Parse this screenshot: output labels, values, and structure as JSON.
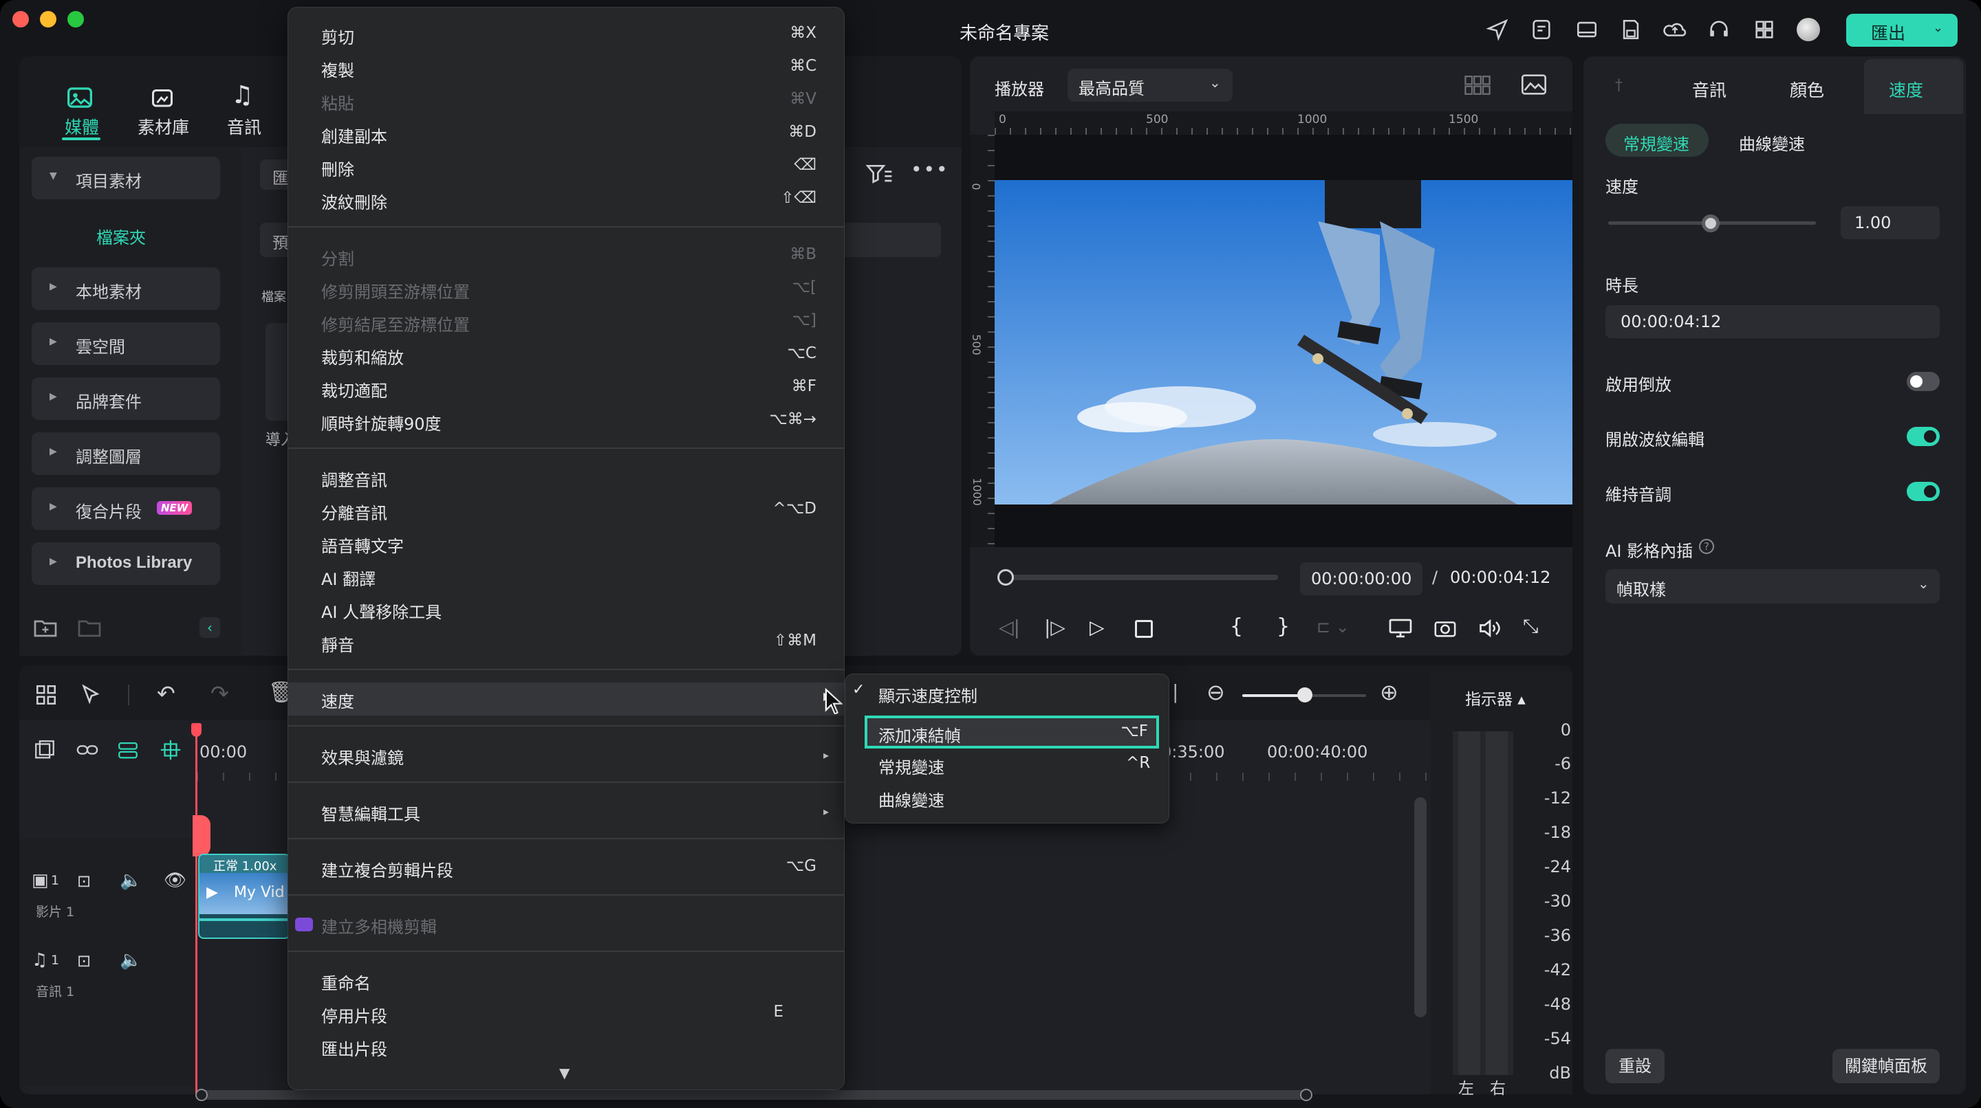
{
  "app": {
    "title": "未命名專案",
    "export_label": "匯出",
    "accent": "#2fd8b5",
    "icons": [
      "send-icon",
      "task-icon",
      "layout-icon",
      "save-icon",
      "cloud-upload-icon",
      "headset-icon",
      "grid-icon",
      "avatar"
    ]
  },
  "media_tabs": [
    {
      "label": "媒體",
      "icon": "media-icon",
      "active": true
    },
    {
      "label": "素材庫",
      "icon": "stock-icon",
      "active": false
    },
    {
      "label": "音訊",
      "icon": "music-icon",
      "active": false
    }
  ],
  "sidebar": {
    "project_media": "項目素材",
    "folder": "檔案夾",
    "items": [
      "本地素材",
      "雲空間",
      "品牌套件",
      "調整圖層",
      "復合片段",
      "Photos Library"
    ],
    "new_badge": "NEW"
  },
  "media_panel": {
    "tab_partial": "匯",
    "search_partial": "預",
    "folder_partial": "檔案",
    "import_partial": "導入"
  },
  "player": {
    "label": "播放器",
    "quality": "最高品質",
    "ruler_marks": [
      "0",
      "500",
      "1000",
      "1500"
    ],
    "vruler_marks": [
      "0",
      "500",
      "1000"
    ],
    "current_time": "00:00:00:00",
    "separator": "/",
    "total_time": "00:00:04:12",
    "progress": 0
  },
  "inspector": {
    "tabs": [
      "音訊",
      "顏色",
      "速度"
    ],
    "active_tab": "速度",
    "speed_modes": [
      "常規變速",
      "曲線變速"
    ],
    "speed_label": "速度",
    "speed_value": "1.00",
    "duration_label": "時長",
    "duration_value": "00:00:04:12",
    "toggles": [
      {
        "label": "啟用倒放",
        "on": false
      },
      {
        "label": "開啟波紋編輯",
        "on": true
      },
      {
        "label": "維持音調",
        "on": true
      }
    ],
    "ai_label": "AI 影格內插",
    "ai_value": "幀取樣",
    "reset": "重設",
    "keyframe_panel": "關鍵幀面板"
  },
  "context_menu": {
    "items": [
      {
        "label": "剪切",
        "shortcut": "⌘X",
        "disabled": false
      },
      {
        "label": "複製",
        "shortcut": "⌘C",
        "disabled": false
      },
      {
        "label": "粘貼",
        "shortcut": "⌘V",
        "disabled": true
      },
      {
        "label": "創建副本",
        "shortcut": "⌘D",
        "disabled": false
      },
      {
        "label": "刪除",
        "shortcut": "⌫",
        "disabled": false
      },
      {
        "label": "波紋刪除",
        "shortcut": "⇧⌫",
        "disabled": false
      },
      {
        "label": "分割",
        "shortcut": "⌘B",
        "disabled": true
      },
      {
        "label": "修剪開頭至游標位置",
        "shortcut": "⌥[",
        "disabled": true
      },
      {
        "label": "修剪結尾至游標位置",
        "shortcut": "⌥]",
        "disabled": true
      },
      {
        "label": "裁剪和縮放",
        "shortcut": "⌥C",
        "disabled": false
      },
      {
        "label": "裁切適配",
        "shortcut": "⌘F",
        "disabled": false
      },
      {
        "label": "順時針旋轉90度",
        "shortcut": "⌥⌘→",
        "disabled": false
      },
      {
        "label": "調整音訊",
        "shortcut": "",
        "disabled": false
      },
      {
        "label": "分離音訊",
        "shortcut": "^⌥D",
        "disabled": false
      },
      {
        "label": "語音轉文字",
        "shortcut": "",
        "disabled": false
      },
      {
        "label": "AI 翻譯",
        "shortcut": "",
        "disabled": false
      },
      {
        "label": "AI 人聲移除工具",
        "shortcut": "",
        "disabled": false
      },
      {
        "label": "靜音",
        "shortcut": "⇧⌘M",
        "disabled": false
      },
      {
        "label": "速度",
        "shortcut": "",
        "disabled": false
      },
      {
        "label": "效果與濾鏡",
        "shortcut": "",
        "disabled": false
      },
      {
        "label": "智慧編輯工具",
        "shortcut": "",
        "disabled": false
      },
      {
        "label": "建立複合剪輯片段",
        "shortcut": "⌥G",
        "disabled": false
      },
      {
        "label": "建立多相機剪輯",
        "shortcut": "",
        "disabled": true
      },
      {
        "label": "重命名",
        "shortcut": "",
        "disabled": false
      },
      {
        "label": "停用片段",
        "shortcut": "E",
        "disabled": false
      },
      {
        "label": "匯出片段",
        "shortcut": "",
        "disabled": false
      }
    ],
    "more_arrow": "▼"
  },
  "speed_submenu": {
    "items": [
      {
        "label": "顯示速度控制",
        "shortcut": "",
        "checked": true
      },
      {
        "label": "添加凍結幀",
        "shortcut": "⌥F",
        "highlighted": true
      },
      {
        "label": "常規變速",
        "shortcut": "^R"
      },
      {
        "label": "曲線變速",
        "shortcut": ""
      }
    ],
    "check": "✓"
  },
  "timeline": {
    "time_marks": [
      "00:00",
      "0:35:00",
      "00:00:40:00"
    ],
    "clip_speed": "正常 1.00x",
    "clip_name": "My Vid",
    "video_track": "影片 1",
    "audio_track": "音訊 1",
    "track_num": "1",
    "meter_label": "指示器",
    "meter_scale": [
      "0",
      "-6",
      "-12",
      "-18",
      "-24",
      "-30",
      "-36",
      "-42",
      "-48",
      "-54",
      "dB"
    ],
    "meter_left": "左",
    "meter_right": "右"
  }
}
